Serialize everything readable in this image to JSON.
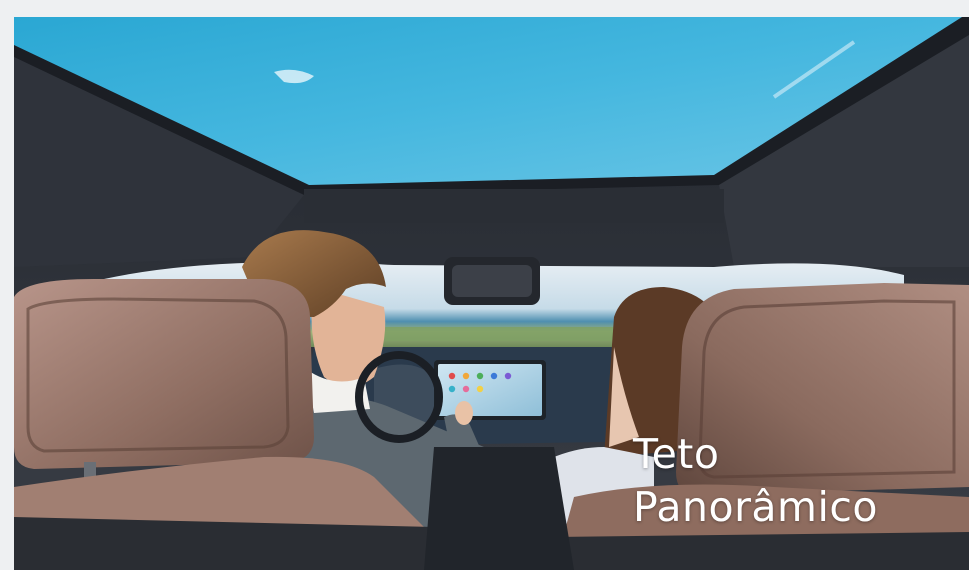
{
  "caption": {
    "line1": "Teto",
    "line2": "Panorâmico"
  },
  "colors": {
    "sky": "#3fb2dd",
    "headliner": "#2c3038",
    "seat_leather": "#9a7a6c",
    "caption_text": "#ffffff"
  }
}
